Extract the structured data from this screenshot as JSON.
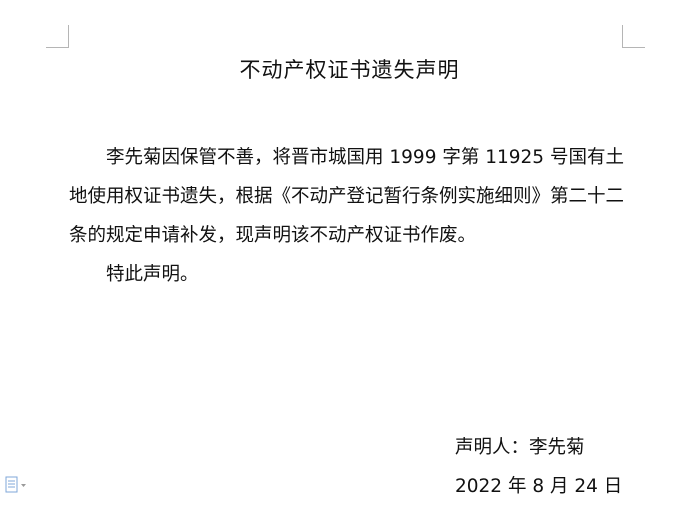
{
  "document": {
    "title": "不动产权证书遗失声明",
    "paragraphs": [
      "李先菊因保管不善，将晋市城国用 1999 字第 11925 号国有土地使用权证书遗失，根据《不动产登记暂行条例实施细则》第二十二条的规定申请补发，现声明该不动产权证书作废。",
      "特此声明。"
    ],
    "signature": {
      "declarant": "声明人：李先菊",
      "date": "2022 年 8 月 24 日"
    }
  },
  "icons": {
    "paste_options": "document-options-icon"
  },
  "colors": {
    "crop_marks": "#b5b5b5",
    "text": "#111111",
    "icon": "#7fa7d9"
  }
}
